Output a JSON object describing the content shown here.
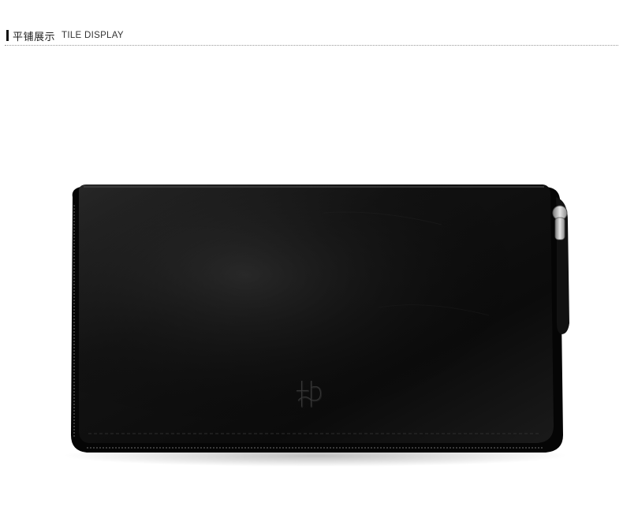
{
  "header": {
    "title_cn": "平铺展示",
    "title_en": "TILE DISPLAY"
  },
  "product": {
    "image_name": "black-leather-zip-wallet",
    "colors": {
      "leather": "#0d0d0d",
      "leather_highlight": "#2b2b2b",
      "zipper_metal": "#b8b8b8",
      "background": "#ffffff"
    }
  }
}
